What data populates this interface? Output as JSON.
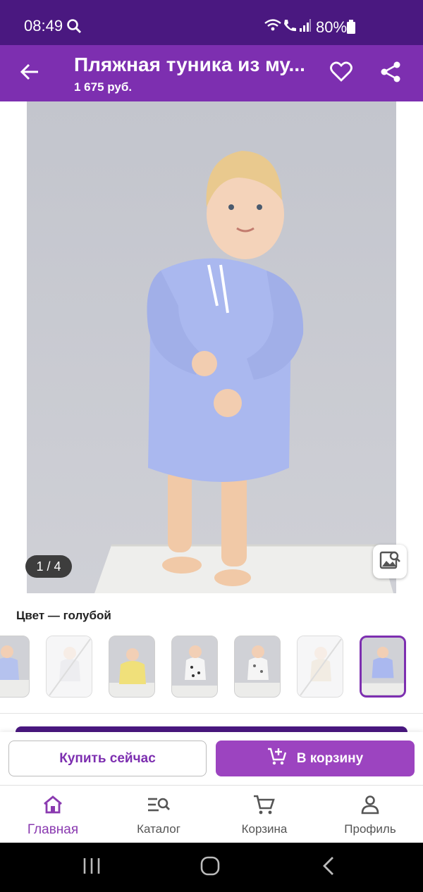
{
  "status_bar": {
    "time": "08:49",
    "battery": "80%"
  },
  "header": {
    "title": "Пляжная туника из му...",
    "price": "1 675 руб."
  },
  "gallery": {
    "counter": "1 / 4"
  },
  "color": {
    "label": "Цвет — голубой"
  },
  "actions": {
    "buy_now": "Купить сейчас",
    "add_to_cart": "В корзину"
  },
  "nav": {
    "home": "Главная",
    "catalog": "Каталог",
    "cart": "Корзина",
    "profile": "Профиль"
  },
  "colors": {
    "header": "#7d2fb0",
    "status": "#4a1880",
    "accent": "#9c44c0"
  }
}
